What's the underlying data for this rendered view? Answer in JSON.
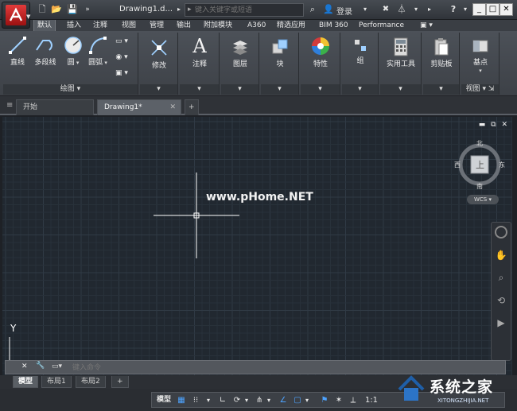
{
  "app": {
    "doc_title": "Drawing1.d...",
    "search_placeholder": "键入关键字或短语",
    "login_label": "登录",
    "help_label": "?"
  },
  "ribbon_tabs": [
    {
      "label": "默认",
      "active": true
    },
    {
      "label": "插入"
    },
    {
      "label": "注释"
    },
    {
      "label": "视图"
    },
    {
      "label": "管理"
    },
    {
      "label": "输出"
    },
    {
      "label": "附加模块"
    },
    {
      "label": "A360"
    },
    {
      "label": "精选应用"
    },
    {
      "label": "BIM 360"
    },
    {
      "label": "Performance"
    }
  ],
  "ribbon": {
    "draw_tools": {
      "line": "直线",
      "polyline": "多段线",
      "circle": "圆",
      "arc": "圆弧"
    },
    "draw_panel_title": "绘图",
    "modify": "修改",
    "annotation": "注释",
    "layers": "图层",
    "block": "块",
    "properties": "特性",
    "groups": "组",
    "utilities": "实用工具",
    "clipboard": "剪贴板",
    "base": "基点",
    "view_panel_title": "视图"
  },
  "file_tabs": [
    {
      "label": "开始"
    },
    {
      "label": "Drawing1*",
      "active": true
    }
  ],
  "canvas": {
    "watermark": "www.pHome.NET",
    "viewcube": {
      "north": "北",
      "south": "南",
      "east": "东",
      "west": "西",
      "top": "上"
    },
    "wcs": "WCS",
    "ucs_y": "Y"
  },
  "command": {
    "placeholder": "键入命令"
  },
  "layout_tabs": [
    {
      "label": "模型",
      "active": true
    },
    {
      "label": "布局1"
    },
    {
      "label": "布局2"
    }
  ],
  "status": {
    "model": "模型",
    "scale": "1:1"
  },
  "brand": {
    "name": "系统之家",
    "url": "XITONGZHIJIA.NET"
  }
}
